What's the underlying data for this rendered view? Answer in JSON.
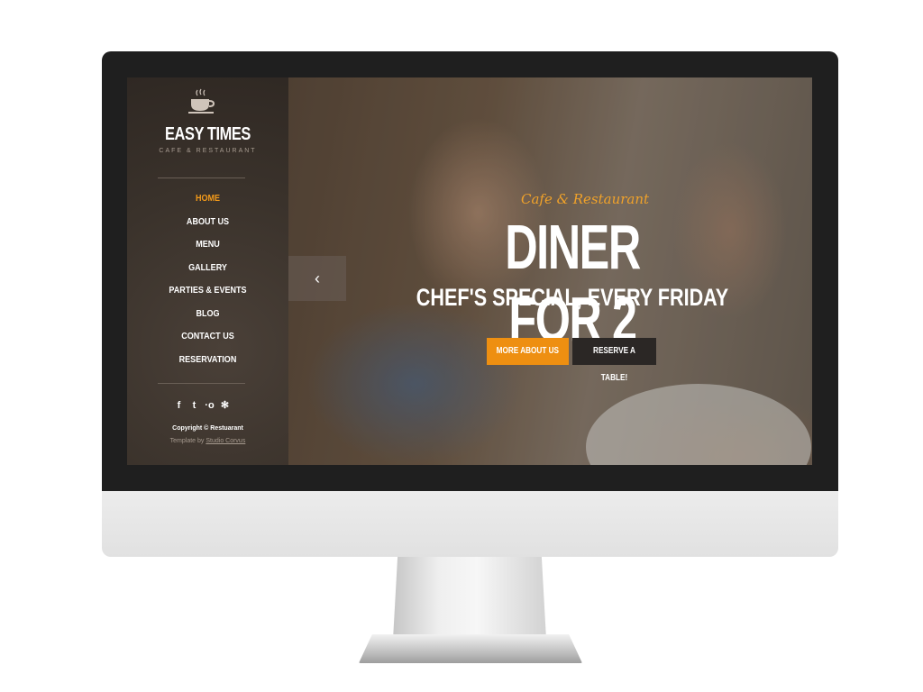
{
  "site": {
    "name": "EASY TIMES",
    "tagline": "CAFE & RESTAURANT"
  },
  "nav": {
    "items": [
      {
        "label": "HOME",
        "active": true
      },
      {
        "label": "ABOUT US"
      },
      {
        "label": "MENU"
      },
      {
        "label": "GALLERY"
      },
      {
        "label": "PARTIES & EVENTS"
      },
      {
        "label": "BLOG"
      },
      {
        "label": "CONTACT US"
      },
      {
        "label": "RESERVATION"
      }
    ]
  },
  "social": {
    "icons": [
      "facebook-icon",
      "twitter-icon",
      "flickr-icon",
      "yelp-icon"
    ],
    "glyphs": [
      "f",
      "t",
      "·o",
      "✻"
    ]
  },
  "footer": {
    "copyright": "Copyright © Restuarant",
    "template_prefix": "Template by",
    "template_link": "Studio Corvus"
  },
  "hero": {
    "script_text": "Cafe & Restaurant",
    "headline": "DINER FOR 2",
    "subheadline": "CHEF'S SPECIAL, EVERY FRIDAY",
    "primary_button": "MORE ABOUT US",
    "secondary_button": "RESERVE A TABLE!",
    "prev_arrow": "‹"
  },
  "colors": {
    "accent": "#ee8f11",
    "active_nav": "#f39a1a",
    "sidebar_bg": "#3a322b",
    "bezel": "#1f1f1f"
  }
}
